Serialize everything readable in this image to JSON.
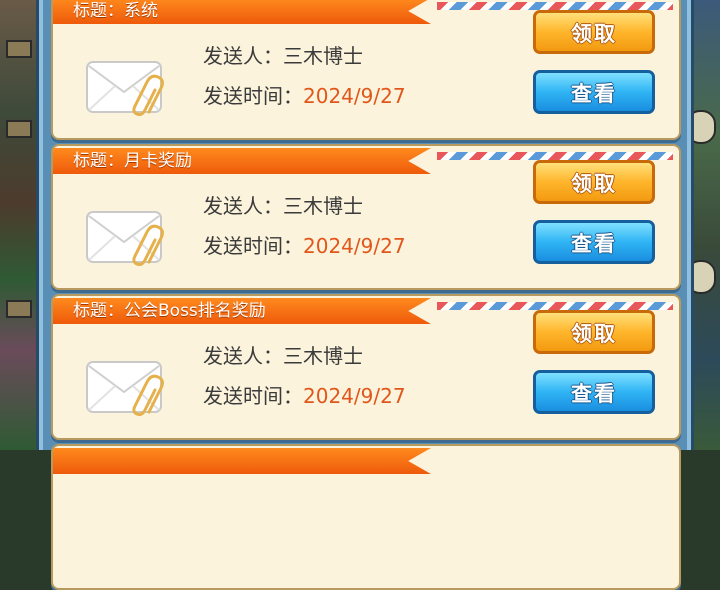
{
  "mails": [
    {
      "title_prefix": "标题：",
      "title": "系统",
      "sender_label": "发送人：",
      "sender": "三木博士",
      "time_label": "发送时间：",
      "date": "2024/9/27",
      "claim_label": "领取",
      "view_label": "查看"
    },
    {
      "title_prefix": "标题：",
      "title": "月卡奖励",
      "sender_label": "发送人：",
      "sender": "三木博士",
      "time_label": "发送时间：",
      "date": "2024/9/27",
      "claim_label": "领取",
      "view_label": "查看"
    },
    {
      "title_prefix": "标题：",
      "title": "公会Boss排名奖励",
      "sender_label": "发送人：",
      "sender": "三木博士",
      "time_label": "发送时间：",
      "date": "2024/9/27",
      "claim_label": "领取",
      "view_label": "查看"
    }
  ],
  "colors": {
    "ribbon": "#ee5a0a",
    "date": "#e1561a",
    "claim_button": "#ffb52b",
    "view_button": "#2fb4f4"
  },
  "icons": [
    "envelope-icon",
    "paperclip-icon"
  ]
}
